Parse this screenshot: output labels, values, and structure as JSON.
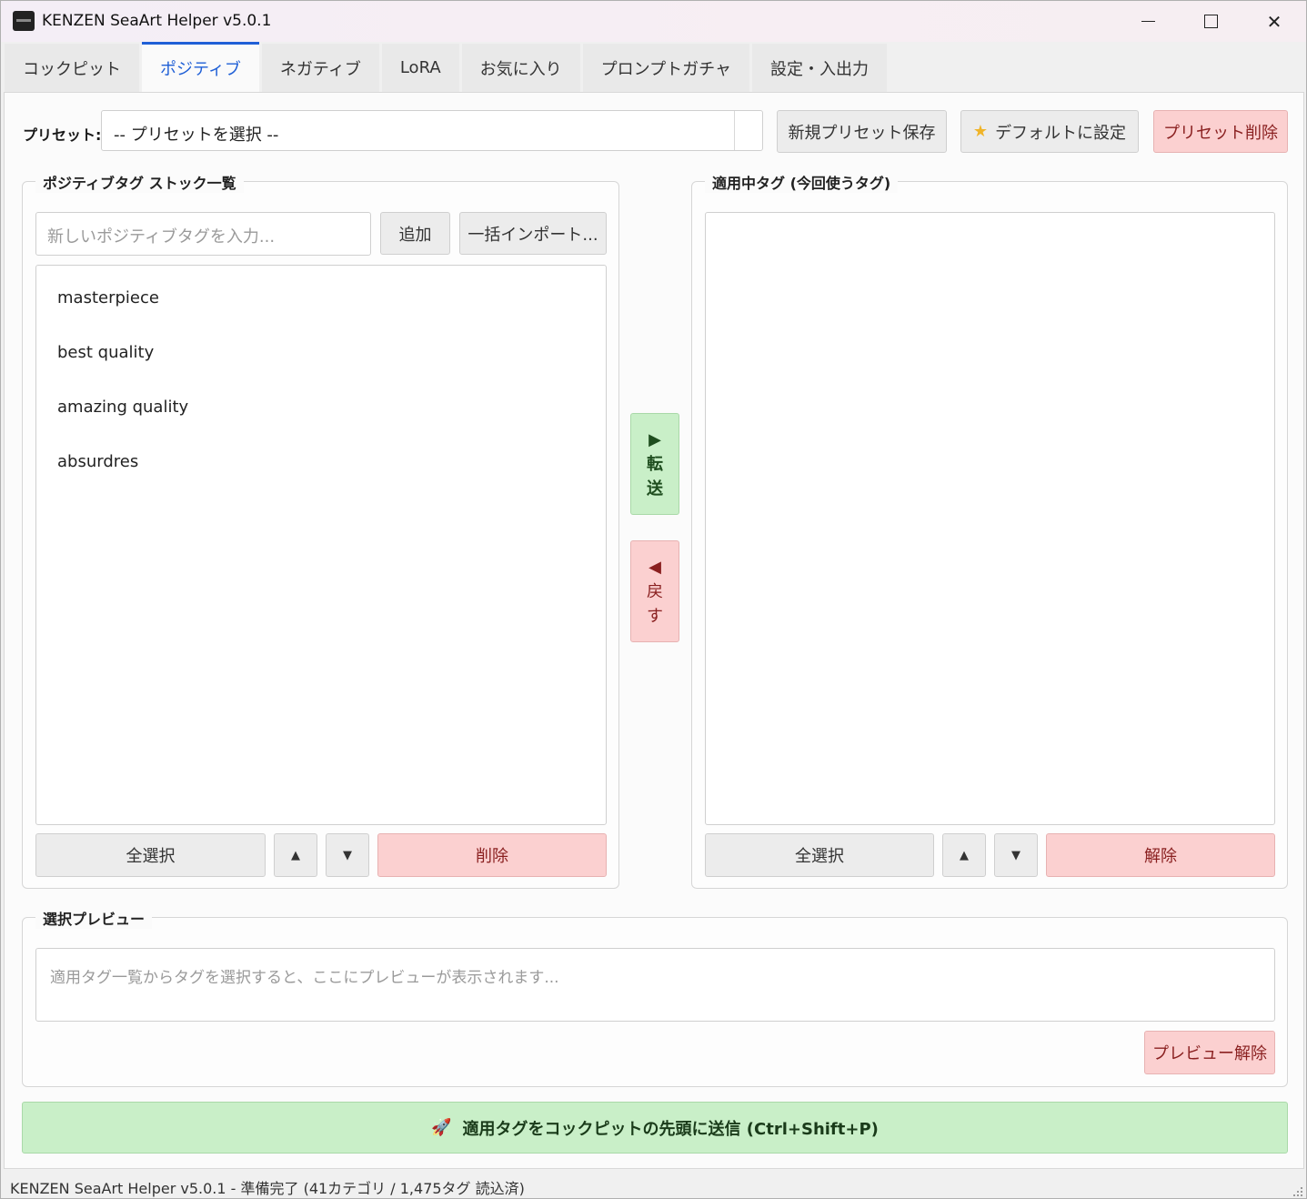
{
  "window": {
    "title": "KENZEN SeaArt Helper v5.0.1"
  },
  "tabs": [
    {
      "label": "コックピット"
    },
    {
      "label": "ポジティブ"
    },
    {
      "label": "ネガティブ"
    },
    {
      "label": "LoRA"
    },
    {
      "label": "お気に入り"
    },
    {
      "label": "プロンプトガチャ"
    },
    {
      "label": "設定・入出力"
    }
  ],
  "preset": {
    "label": "プリセット:",
    "selected": "-- プリセットを選択 --",
    "save_label": "新規プリセット保存",
    "default_label": "デフォルトに設定",
    "delete_label": "プリセット削除"
  },
  "stock": {
    "title": "ポジティブタグ ストック一覧",
    "input_placeholder": "新しいポジティブタグを入力...",
    "add_label": "追加",
    "import_label": "一括インポート...",
    "items": [
      "masterpiece",
      "best quality",
      "amazing quality",
      "absurdres"
    ],
    "select_all_label": "全選択",
    "up_label": "▲",
    "down_label": "▼",
    "delete_label": "削除"
  },
  "transfer": {
    "forward_glyph": "▶",
    "forward_chars": [
      "転",
      "送"
    ],
    "back_glyph": "◀",
    "back_chars": [
      "戻",
      "す"
    ]
  },
  "applied": {
    "title": "適用中タグ (今回使うタグ)",
    "select_all_label": "全選択",
    "up_label": "▲",
    "down_label": "▼",
    "remove_label": "解除"
  },
  "preview": {
    "title": "選択プレビュー",
    "placeholder": "適用タグ一覧からタグを選択すると、ここにプレビューが表示されます...",
    "clear_label": "プレビュー解除"
  },
  "send": {
    "label": "適用タグをコックピットの先頭に送信 (Ctrl+Shift+P)"
  },
  "status": {
    "text": "KENZEN SeaArt Helper v5.0.1 - 準備完了 (41カテゴリ / 1,475タグ 読込済)"
  },
  "colors": {
    "accent": "#1f5fd6",
    "danger_bg": "#fbd0d0",
    "success_bg": "#c9efc8"
  }
}
